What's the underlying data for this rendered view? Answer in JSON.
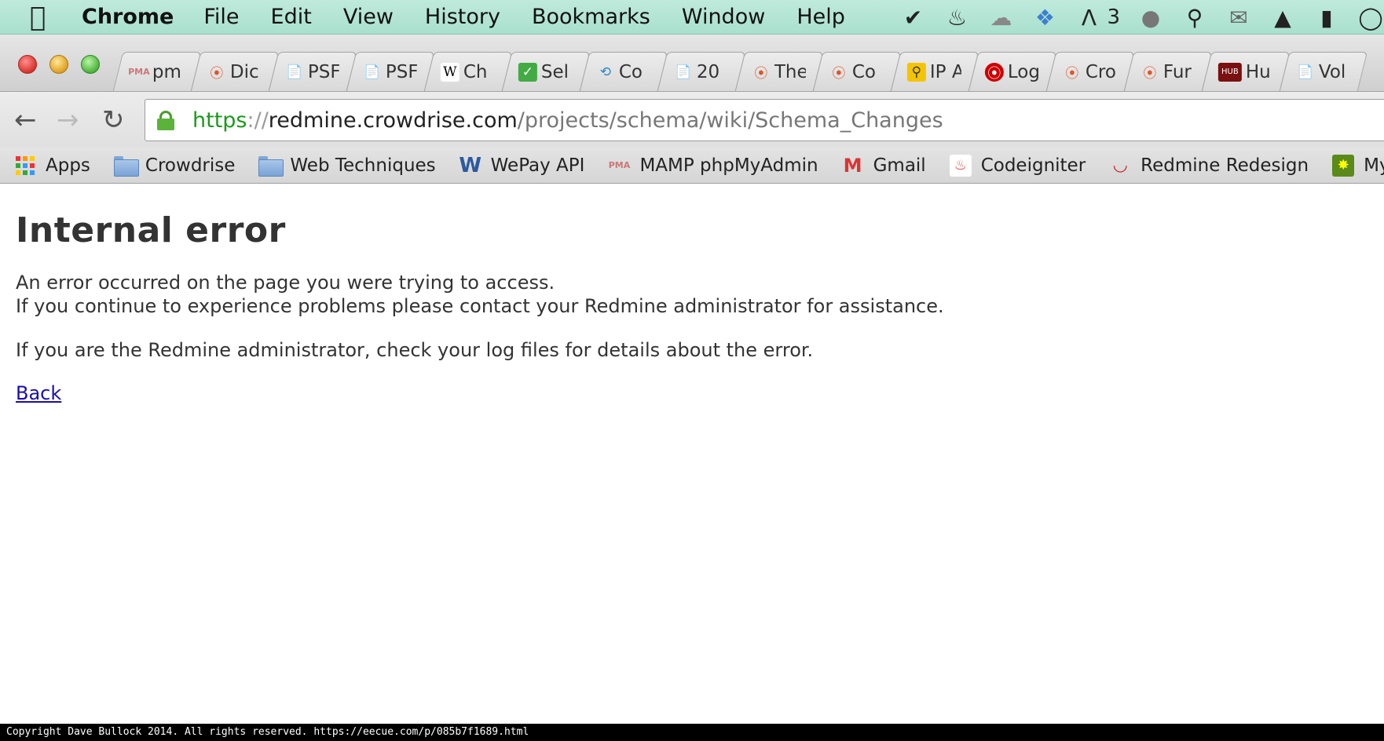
{
  "menubar": {
    "app_name": "Chrome",
    "items": [
      "File",
      "Edit",
      "View",
      "History",
      "Bookmarks",
      "Window",
      "Help"
    ],
    "status_icons": [
      "checkmark-badge-icon",
      "flame-icon",
      "creative-cloud-icon",
      "dropbox-icon",
      "adobe-icon",
      "chat-bubble-icon",
      "key-icon",
      "mail-icon",
      "airplay-icon",
      "battery-icon",
      "speech-icon"
    ],
    "adobe_count": "3"
  },
  "tabs": [
    {
      "title": "pm",
      "icon": "phpmyadmin-icon"
    },
    {
      "title": "Dic",
      "icon": "redmine-icon"
    },
    {
      "title": "PSF",
      "icon": "page-icon"
    },
    {
      "title": "PSF",
      "icon": "page-icon"
    },
    {
      "title": "Ch",
      "icon": "wikipedia-icon"
    },
    {
      "title": "Sel",
      "icon": "checkbox-icon"
    },
    {
      "title": "Co",
      "icon": "codeigniter-icon"
    },
    {
      "title": "20",
      "icon": "page-icon"
    },
    {
      "title": "The",
      "icon": "redmine-icon"
    },
    {
      "title": "Co",
      "icon": "redmine-icon"
    },
    {
      "title": "IP A",
      "icon": "search-icon"
    },
    {
      "title": "Log",
      "icon": "redmine-red-icon"
    },
    {
      "title": "Cro",
      "icon": "redmine-icon"
    },
    {
      "title": "Fur",
      "icon": "redmine-icon"
    },
    {
      "title": "Hu",
      "icon": "hub-icon"
    },
    {
      "title": "Vol",
      "icon": "page-icon"
    }
  ],
  "hub_label": "HUB",
  "address_bar": {
    "scheme": "https",
    "separator": "://",
    "host": "redmine.crowdrise.com",
    "path": "/projects/schema/wiki/Schema_Changes"
  },
  "bookmarks": [
    {
      "label": "Apps",
      "icon": "apps-grid-icon"
    },
    {
      "label": "Crowdrise",
      "icon": "folder-icon"
    },
    {
      "label": "Web Techniques",
      "icon": "folder-icon"
    },
    {
      "label": "WePay API",
      "icon": "wepay-icon"
    },
    {
      "label": "MAMP phpMyAdmin",
      "icon": "phpmyadmin-icon"
    },
    {
      "label": "Gmail",
      "icon": "gmail-icon"
    },
    {
      "label": "Codeigniter",
      "icon": "codeigniter-icon"
    },
    {
      "label": "Redmine Redesign",
      "icon": "redmine-icon"
    },
    {
      "label": "MyS",
      "icon": "mysql-icon"
    }
  ],
  "page": {
    "heading": "Internal error",
    "line1": "An error occurred on the page you were trying to access.",
    "line2": "If you continue to experience problems please contact your Redmine administrator for assistance.",
    "line3": "If you are the Redmine administrator, check your log files for details about the error.",
    "back_link": "Back"
  },
  "footer": "Copyright Dave Bullock 2014. All rights reserved. https://eecue.com/p/085b7f1689.html"
}
